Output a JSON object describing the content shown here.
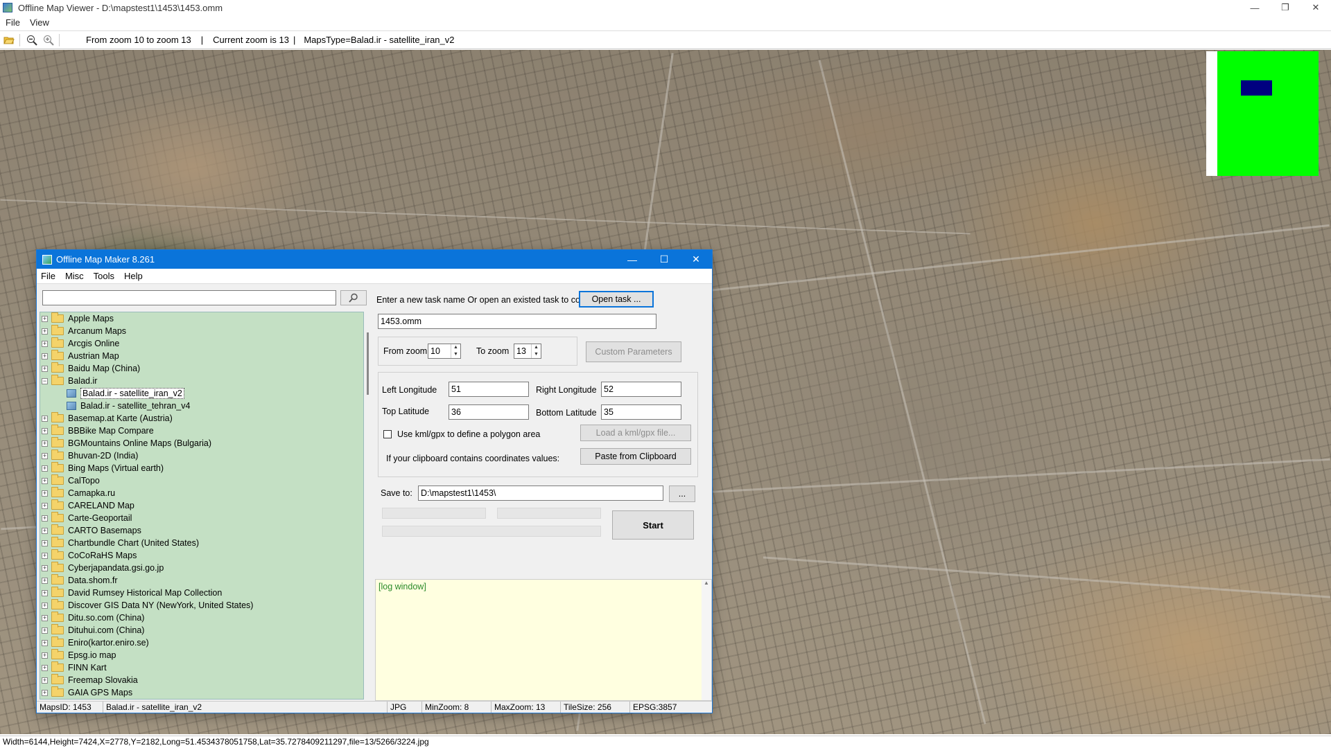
{
  "viewer": {
    "title": "Offline Map Viewer - D:\\mapstest1\\1453\\1453.omm",
    "menu": [
      "File",
      "View"
    ],
    "window_controls": {
      "minimize": "—",
      "restore": "❐",
      "close": "✕"
    },
    "toolbar": {
      "zoom_range": "From zoom 10 to zoom 13",
      "current_zoom": "Current zoom is 13",
      "maps_type": "MapsType=Balad.ir - satellite_iran_v2",
      "separator": "|"
    },
    "status": "Width=6144,Height=7424,X=2778,Y=2182,Long=51.4534378051758,Lat=35.7278409211297,file=13/5266/3224.jpg",
    "icons": [
      "open-folder-icon",
      "zoom-out-icon",
      "zoom-in-icon"
    ]
  },
  "dialog": {
    "title": "Offline Map Maker 8.261",
    "window_controls": {
      "minimize": "—",
      "maximize": "☐",
      "close": "✕"
    },
    "menu": [
      "File",
      "Misc",
      "Tools",
      "Help"
    ],
    "search": {
      "value": "",
      "placeholder": ""
    },
    "tree": [
      {
        "label": "Apple Maps",
        "expanded": false
      },
      {
        "label": "Arcanum Maps",
        "expanded": false
      },
      {
        "label": "Arcgis Online",
        "expanded": false
      },
      {
        "label": "Austrian Map",
        "expanded": false
      },
      {
        "label": "Baidu Map (China)",
        "expanded": false
      },
      {
        "label": "Balad.ir",
        "expanded": true,
        "children": [
          {
            "label": "Balad.ir - satellite_iran_v2",
            "selected": true
          },
          {
            "label": "Balad.ir - satellite_tehran_v4",
            "selected": false
          }
        ]
      },
      {
        "label": "Basemap.at Karte (Austria)",
        "expanded": false
      },
      {
        "label": "BBBike Map Compare",
        "expanded": false
      },
      {
        "label": "BGMountains Online Maps (Bulgaria)",
        "expanded": false
      },
      {
        "label": "Bhuvan-2D (India)",
        "expanded": false
      },
      {
        "label": "Bing Maps (Virtual earth)",
        "expanded": false
      },
      {
        "label": "CalTopo",
        "expanded": false
      },
      {
        "label": "Camapka.ru",
        "expanded": false
      },
      {
        "label": "CARELAND Map",
        "expanded": false
      },
      {
        "label": "Carte-Geoportail",
        "expanded": false
      },
      {
        "label": "CARTO Basemaps",
        "expanded": false
      },
      {
        "label": "Chartbundle Chart (United States)",
        "expanded": false
      },
      {
        "label": "CoCoRaHS Maps",
        "expanded": false
      },
      {
        "label": "Cyberjapandata.gsi.go.jp",
        "expanded": false
      },
      {
        "label": "Data.shom.fr",
        "expanded": false
      },
      {
        "label": "David Rumsey Historical Map Collection",
        "expanded": false
      },
      {
        "label": "Discover GIS Data NY (NewYork, United States)",
        "expanded": false
      },
      {
        "label": "Ditu.so.com (China)",
        "expanded": false
      },
      {
        "label": "Dituhui.com (China)",
        "expanded": false
      },
      {
        "label": "Eniro(kartor.eniro.se)",
        "expanded": false
      },
      {
        "label": "Epsg.io map",
        "expanded": false
      },
      {
        "label": "FINN Kart",
        "expanded": false
      },
      {
        "label": "Freemap Slovakia",
        "expanded": false
      },
      {
        "label": "GAIA GPS Maps",
        "expanded": false
      }
    ],
    "task": {
      "prompt": "Enter a new task name Or open an existed task to continue:",
      "open_button": "Open task ...",
      "name_value": "1453.omm"
    },
    "zoom": {
      "from_label": "From zoom",
      "from_value": "10",
      "to_label": "To zoom",
      "to_value": "13",
      "custom_button": "Custom Parameters"
    },
    "coords": {
      "left_lon_label": "Left Longitude",
      "left_lon_value": "51",
      "right_lon_label": "Right Longitude",
      "right_lon_value": "52",
      "top_lat_label": "Top Latitude",
      "top_lat_value": "36",
      "bottom_lat_label": "Bottom Latitude",
      "bottom_lat_value": "35",
      "kml_label": "Use kml/gpx to define a polygon area",
      "kml_checked": false,
      "load_kml_button": "Load a kml/gpx file...",
      "clipboard_label": "If your clipboard contains coordinates values:",
      "paste_button": "Paste from Clipboard"
    },
    "save": {
      "label": "Save to:",
      "value": "D:\\mapstest1\\1453\\",
      "browse_button": "...",
      "start_button": "Start"
    },
    "log": {
      "text": "[log window]"
    },
    "statusbar": {
      "maps_id": "MapsID: 1453",
      "map_name": "Balad.ir - satellite_iran_v2",
      "format": "JPG",
      "min_zoom": "MinZoom: 8",
      "max_zoom": "MaxZoom: 13",
      "tile_size": "TileSize: 256",
      "epsg": "EPSG:3857"
    }
  },
  "colors": {
    "dialog_titlebar": "#0a74da",
    "tree_background": "#c4e0c4",
    "log_background": "#ffffe0",
    "minimap_green": "#00ff00",
    "minimap_viewport": "#000080"
  }
}
